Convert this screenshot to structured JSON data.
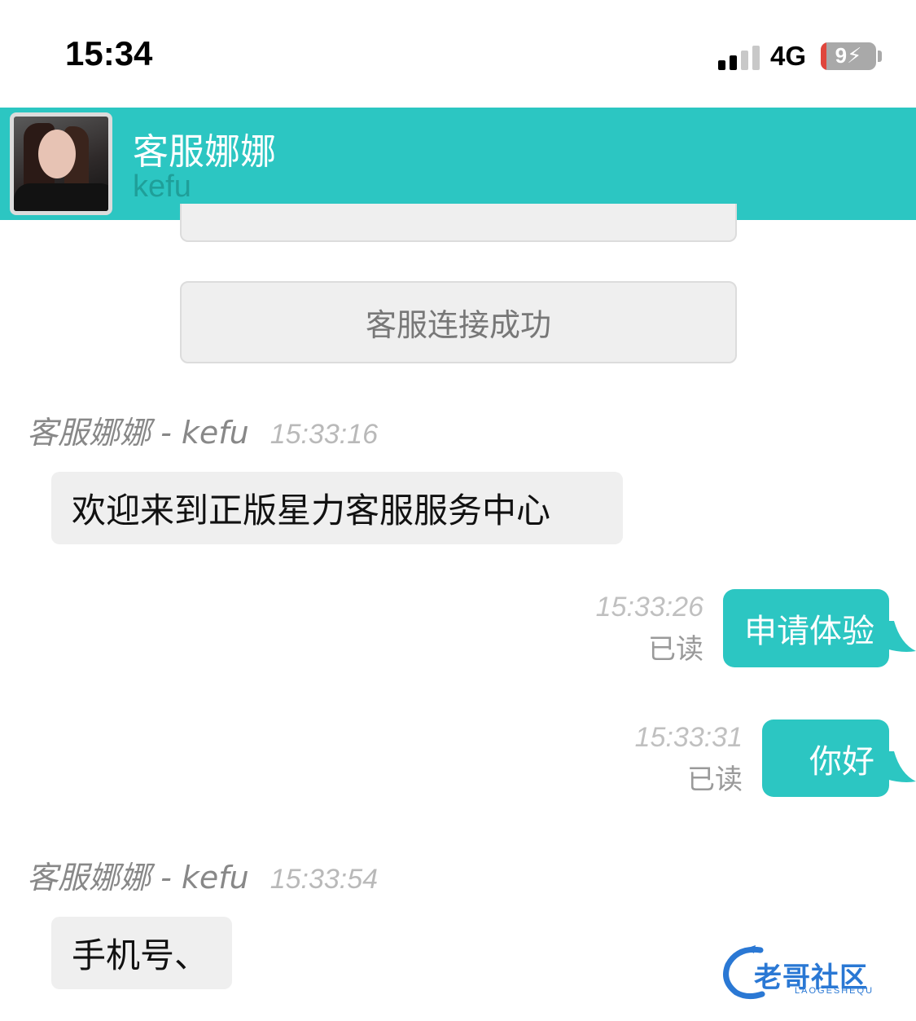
{
  "status_bar": {
    "time": "15:34",
    "network": "4G",
    "battery": "9",
    "battery_level": 0.09
  },
  "header": {
    "name": "客服娜娜",
    "id": "kefu"
  },
  "system_message": "客服连接成功",
  "messages": [
    {
      "sender": "客服娜娜 - kefu",
      "time": "15:33:16",
      "text": "欢迎来到正版星力客服服务中心"
    },
    {
      "time": "15:33:26",
      "status": "已读",
      "text": "申请体验"
    },
    {
      "time": "15:33:31",
      "status": "已读",
      "text": "你好"
    },
    {
      "sender": "客服娜娜 - kefu",
      "time": "15:33:54",
      "text": "手机号、"
    }
  ],
  "watermark": {
    "title": "老哥社区",
    "subtitle": "LAOGESHEQU"
  },
  "colors": {
    "accent": "#2cc6c2",
    "incoming_bubble": "#efefef",
    "battery_low": "#e0463c"
  }
}
